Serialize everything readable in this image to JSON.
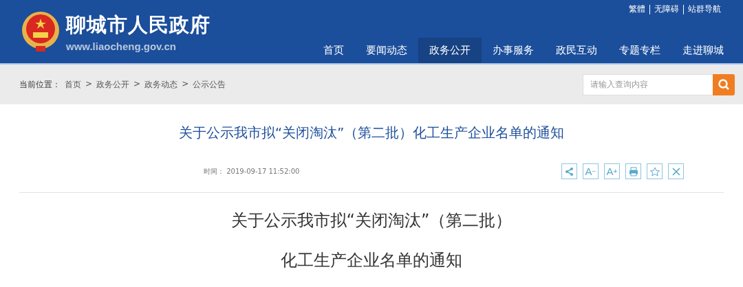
{
  "header": {
    "site_name": "聊城市人民政府",
    "site_url": "www.liaocheng.gov.cn",
    "top_links": [
      "繁體",
      "无障碍",
      "站群导航"
    ],
    "nav": [
      {
        "label": "首页",
        "selected": false
      },
      {
        "label": "要闻动态",
        "selected": false
      },
      {
        "label": "政务公开",
        "selected": true
      },
      {
        "label": "办事服务",
        "selected": false
      },
      {
        "label": "政民互动",
        "selected": false
      },
      {
        "label": "专题专栏",
        "selected": false
      },
      {
        "label": "走进聊城",
        "selected": false
      }
    ]
  },
  "breadcrumb": {
    "label": "当前位置：",
    "items": [
      "首页",
      "政务公开",
      "政务动态",
      "公示公告"
    ],
    "separator": ">"
  },
  "search": {
    "placeholder": "请输入查询内容"
  },
  "article": {
    "title": "关于公示我市拟“关闭淘汰”（第二批）化工生产企业名单的通知",
    "time": "时间： 2019-09-17 11:52:00",
    "tools": [
      {
        "kind": "share"
      },
      {
        "kind": "font",
        "label": "A",
        "sign": "−"
      },
      {
        "kind": "font",
        "label": "A",
        "sign": "+"
      },
      {
        "kind": "print"
      },
      {
        "kind": "favorite"
      },
      {
        "kind": "close"
      }
    ],
    "body_lines": [
      "关于公示我市拟“关闭淘汰”（第二批）",
      "化工生产企业名单的通知"
    ]
  }
}
